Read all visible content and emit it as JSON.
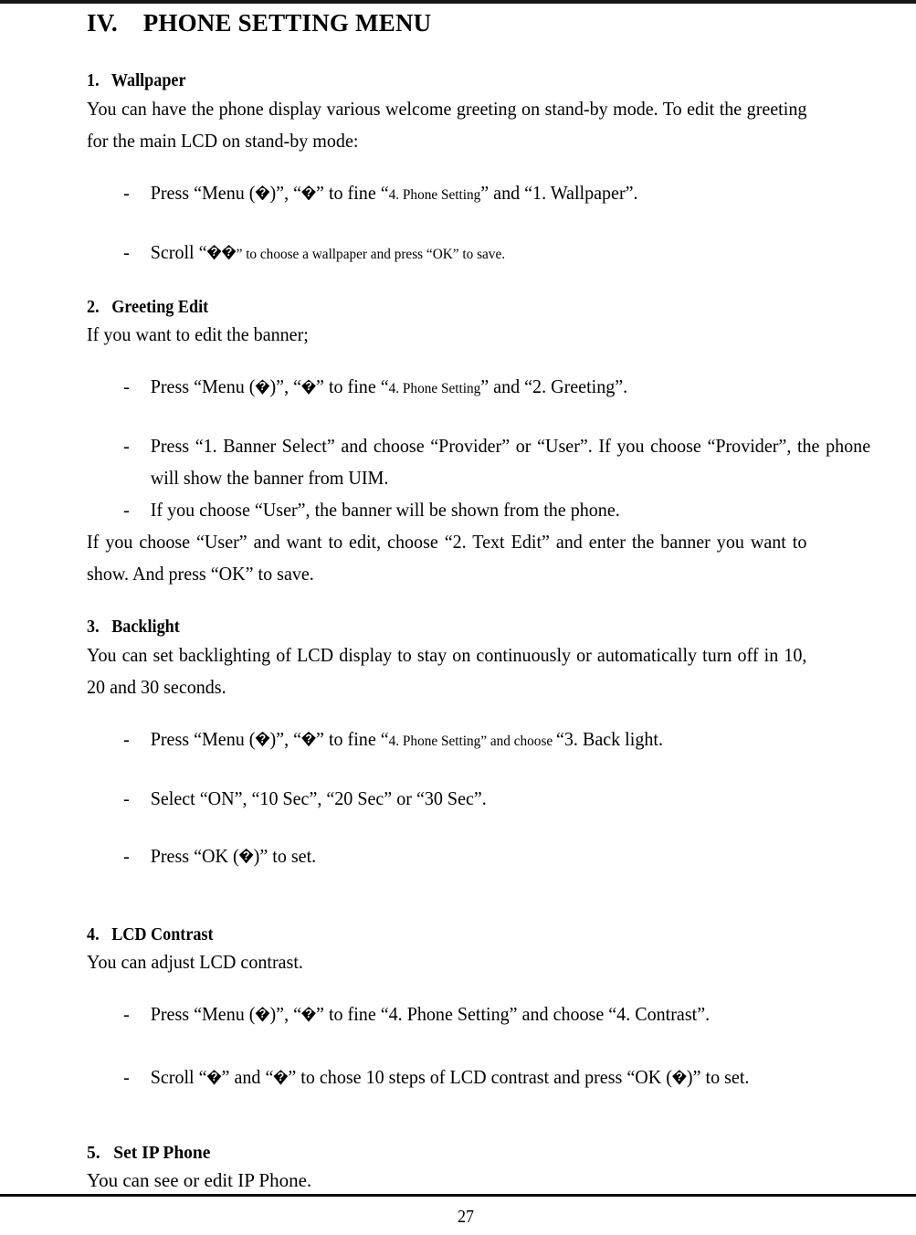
{
  "document": {
    "title_number": "IV.",
    "title_text": "PHONE SETTING MENU",
    "page_number": "27"
  },
  "glyphs": {
    "replacement_char": "�",
    "replacement_name": "replacement-character-diamond"
  },
  "sections": [
    {
      "number": "1.",
      "heading": "Wallpaper",
      "intro": "You can have the phone display various welcome greeting on stand-by mode. To edit the greeting for the main LCD on stand-by mode:",
      "bullets": [
        {
          "dash": "-",
          "parts": [
            {
              "text": "Press “Menu (",
              "size": "normal"
            },
            {
              "text": "�",
              "size": "glyph"
            },
            {
              "text": ")”, “",
              "size": "normal"
            },
            {
              "text": "�",
              "size": "glyph"
            },
            {
              "text": "” to fine “",
              "size": "normal"
            },
            {
              "text": "4. Phone Setting",
              "size": "small"
            },
            {
              "text": "” and “1. Wallpaper”.",
              "size": "normal"
            }
          ]
        },
        {
          "dash": "-",
          "parts": [
            {
              "text": "Scroll “",
              "size": "normal"
            },
            {
              "text": "�",
              "size": "glyph"
            },
            {
              "text": "�",
              "size": "glyph"
            },
            {
              "text": "” to choose a wallpaper and press “OK” to save.",
              "size": "small"
            }
          ]
        }
      ]
    },
    {
      "number": "2.",
      "heading": "Greeting Edit",
      "intro": "If you want to edit the banner;",
      "bullets": [
        {
          "dash": "-",
          "parts": [
            {
              "text": "Press “Menu (",
              "size": "normal"
            },
            {
              "text": "�",
              "size": "glyph"
            },
            {
              "text": ")”, “",
              "size": "normal"
            },
            {
              "text": "�",
              "size": "glyph"
            },
            {
              "text": "” to fine “",
              "size": "normal"
            },
            {
              "text": "4. Phone Setting",
              "size": "small"
            },
            {
              "text": "” and “2. Greeting”.",
              "size": "normal"
            }
          ]
        },
        {
          "dash": "-",
          "parts": [
            {
              "text": "Press “1. Banner Select” and choose “Provider” or “User”. If you choose “Provider”, the phone will show the banner from UIM.",
              "size": "normal"
            }
          ]
        },
        {
          "dash": "-",
          "parts": [
            {
              "text": "If you choose “User”, the banner will be shown from the phone.",
              "size": "normal"
            }
          ]
        }
      ],
      "outro": "If you choose “User” and want to edit, choose “2. Text Edit” and enter the banner you want to show. And press “OK” to save."
    },
    {
      "number": "3.",
      "heading": "Backlight",
      "intro": "You can set backlighting of LCD display to stay on continuously or automatically turn off in 10, 20 and 30 seconds.",
      "bullets": [
        {
          "dash": "-",
          "parts": [
            {
              "text": "Press “Menu (",
              "size": "normal"
            },
            {
              "text": "�",
              "size": "glyph"
            },
            {
              "text": ")”, “",
              "size": "normal"
            },
            {
              "text": "�",
              "size": "glyph"
            },
            {
              "text": "” to fine “",
              "size": "normal"
            },
            {
              "text": "4. Phone Setting",
              "size": "small"
            },
            {
              "text": "” and choose ",
              "size": "small"
            },
            {
              "text": "“3. Back light.",
              "size": "normal"
            }
          ]
        },
        {
          "dash": "-",
          "parts": [
            {
              "text": "Select “ON”, “10 Sec”, “20 Sec” or “30 Sec”.",
              "size": "normal"
            }
          ]
        },
        {
          "dash": "-",
          "parts": [
            {
              "text": "Press “OK (",
              "size": "normal"
            },
            {
              "text": "�",
              "size": "glyph"
            },
            {
              "text": ")” to set.",
              "size": "normal"
            }
          ]
        }
      ]
    },
    {
      "number": "4.",
      "heading": "LCD Contrast",
      "intro": "You can adjust LCD contrast.",
      "bullets": [
        {
          "dash": "-",
          "parts": [
            {
              "text": "Press “Menu (",
              "size": "normal"
            },
            {
              "text": "�",
              "size": "glyph"
            },
            {
              "text": ")”, “",
              "size": "normal"
            },
            {
              "text": "�",
              "size": "glyph"
            },
            {
              "text": "” to fine “4. Phone Setting” and choose “4. Contrast”.",
              "size": "normal"
            }
          ]
        },
        {
          "dash": "-",
          "parts": [
            {
              "text": "Scroll “",
              "size": "normal"
            },
            {
              "text": "�",
              "size": "glyph"
            },
            {
              "text": "” and “",
              "size": "normal"
            },
            {
              "text": "�",
              "size": "glyph"
            },
            {
              "text": "” to chose 10 steps of LCD contrast and press “OK (",
              "size": "normal"
            },
            {
              "text": "�",
              "size": "glyph"
            },
            {
              "text": ")” to set.",
              "size": "normal"
            }
          ]
        }
      ]
    },
    {
      "number": "5.",
      "heading": "Set IP Phone",
      "intro": "You can see or edit IP Phone.",
      "bullets": []
    }
  ]
}
